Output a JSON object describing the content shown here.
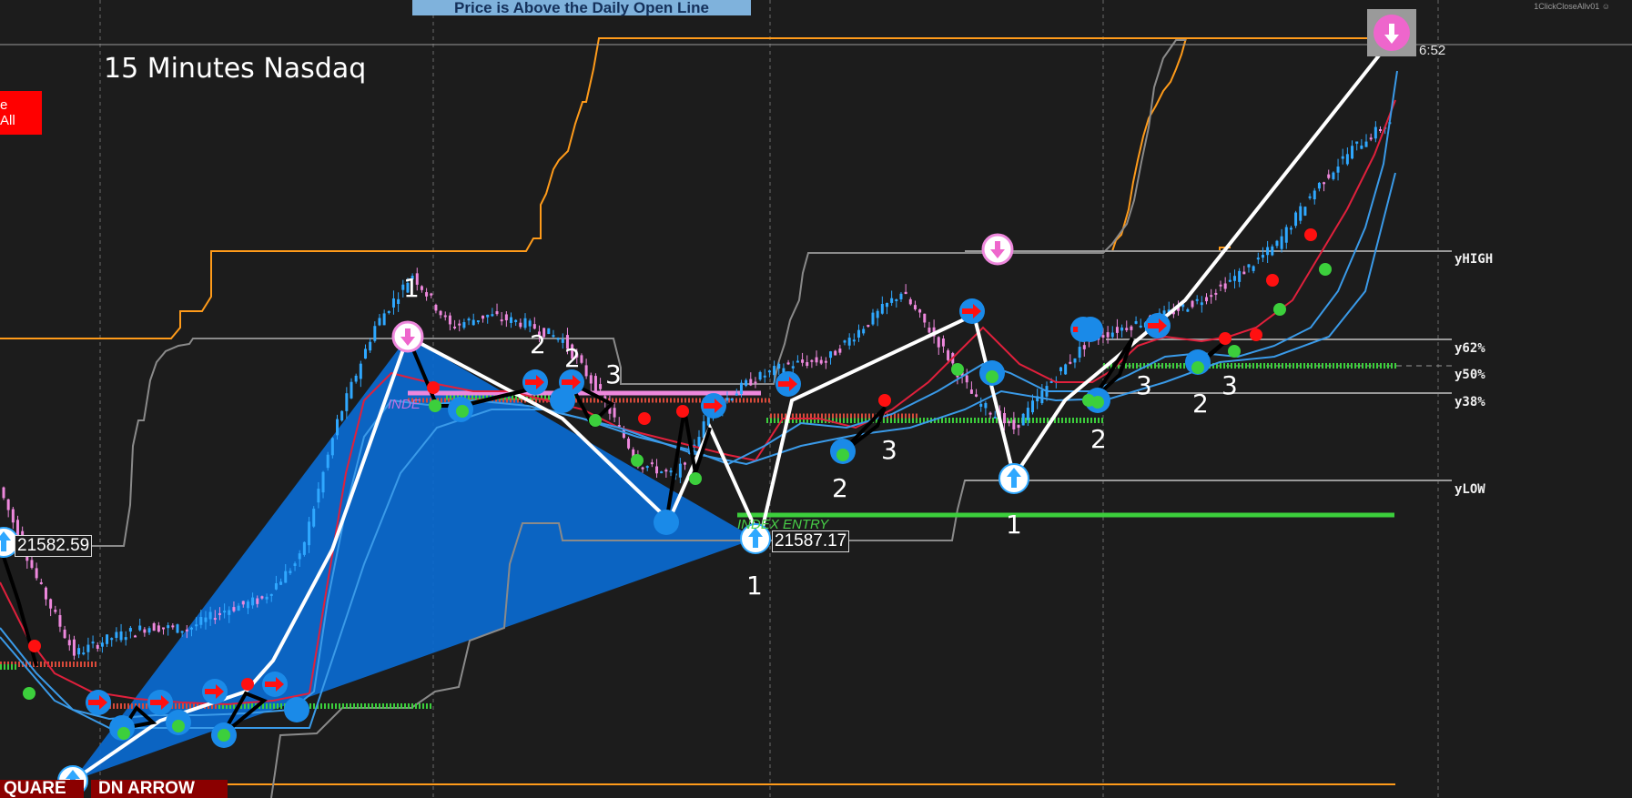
{
  "header": {
    "banner": "Price is Above the Daily Open Line",
    "title": "15 Minutes Nasdaq",
    "close_all_label": "e All",
    "script_tag": "1ClickCloseAllv01 ☺",
    "clock": "6:52"
  },
  "price_labels": {
    "left": "21582.59",
    "middle": "21587.17"
  },
  "level_labels": {
    "yhigh": "yHIGH",
    "y62": "y62%",
    "y50": "y50%",
    "y38": "y38%",
    "ylow": "yLOW"
  },
  "wave_labels": [
    "1",
    "2",
    "2",
    "3",
    "1",
    "2",
    "3",
    "1",
    "2",
    "3",
    "2",
    "3"
  ],
  "bottom_buttons": {
    "square": "QUARE",
    "dn_arrow": "DN ARROW"
  },
  "annotations": {
    "entry": "INDEX ENTRY",
    "indep": "INDE"
  },
  "colors": {
    "background": "#1c1c1c",
    "up_candle": "#2fa8ff",
    "down_candle": "#ee88dd",
    "channel_orange": "#ff9b1a",
    "channel_gray": "#8a8a8a",
    "ma_red": "#e0203c",
    "ma_blue": "#3a9ae8",
    "zone_fill": "#0a6ad0",
    "zigzag": "#ffffff",
    "entry_green": "#3ccf3c"
  },
  "chart_data": {
    "type": "line",
    "title": "15 Minutes Nasdaq",
    "xlabel": "",
    "ylabel": "",
    "grid": true,
    "series": [
      {
        "values": [
          21582,
          21515,
          21460,
          21472,
          21480,
          21478,
          21492,
          21500,
          21530,
          21630,
          21700,
          21738,
          21700,
          21708,
          21702,
          21690,
          21650,
          21600,
          21590,
          21640,
          21660,
          21672,
          21675,
          21700,
          21725,
          21688,
          21645,
          21625,
          21660,
          21690,
          21700,
          21708,
          21720,
          21738,
          21760,
          21800,
          21830,
          21850
        ]
      }
    ]
  }
}
